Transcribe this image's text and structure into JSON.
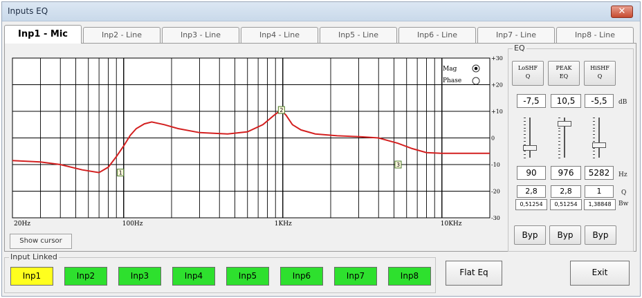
{
  "window": {
    "title": "Inputs EQ",
    "close_glyph": "✕"
  },
  "tabs": [
    {
      "label": "Inp1 - Mic",
      "active": true
    },
    {
      "label": "Inp2 - Line",
      "active": false
    },
    {
      "label": "Inp3 - Line",
      "active": false
    },
    {
      "label": "Inp4 - Line",
      "active": false
    },
    {
      "label": "Inp5 - Line",
      "active": false
    },
    {
      "label": "Inp6 - Line",
      "active": false
    },
    {
      "label": "Inp7 - Line",
      "active": false
    },
    {
      "label": "Inp8 - Line",
      "active": false
    }
  ],
  "graph": {
    "x_ticks": [
      "20Hz",
      "100Hz",
      "1KHz",
      "10KHz"
    ],
    "y_ticks": [
      "+30",
      "+20",
      "+10",
      "0",
      "-10",
      "-20",
      "-30"
    ],
    "mode_mag": "Mag",
    "mode_phase": "Phase",
    "selected_mode": "Mag",
    "curve_color": "#d32020",
    "markers": [
      {
        "label": "1",
        "freq": 95,
        "db": -13
      },
      {
        "label": "2",
        "freq": 976,
        "db": 10.5
      },
      {
        "label": "3",
        "freq": 5282,
        "db": -10
      }
    ],
    "curve": [
      [
        20,
        -8.5
      ],
      [
        30,
        -9
      ],
      [
        40,
        -10
      ],
      [
        55,
        -12
      ],
      [
        70,
        -13
      ],
      [
        80,
        -11
      ],
      [
        90,
        -7
      ],
      [
        100,
        -3
      ],
      [
        110,
        1
      ],
      [
        120,
        3.5
      ],
      [
        135,
        5.3
      ],
      [
        150,
        6
      ],
      [
        180,
        5
      ],
      [
        220,
        3.5
      ],
      [
        300,
        2
      ],
      [
        450,
        1.5
      ],
      [
        600,
        2.3
      ],
      [
        750,
        5
      ],
      [
        880,
        8.5
      ],
      [
        976,
        10.5
      ],
      [
        1050,
        8.5
      ],
      [
        1150,
        5
      ],
      [
        1300,
        3
      ],
      [
        1600,
        1.5
      ],
      [
        2200,
        0.8
      ],
      [
        3000,
        0.5
      ],
      [
        4000,
        0
      ],
      [
        5282,
        -2
      ],
      [
        6500,
        -4
      ],
      [
        8000,
        -5.5
      ],
      [
        10000,
        -5.8
      ],
      [
        15000,
        -5.8
      ],
      [
        20000,
        -5.8
      ]
    ]
  },
  "eq": {
    "title": "EQ",
    "bands": [
      {
        "type_line1": "LoSHF",
        "type_line2": "Q",
        "gain": "-7,5",
        "freq": "90",
        "q": "2,8",
        "bw": "0,51254",
        "bypass": "Byp",
        "gain_value_db": -7.5
      },
      {
        "type_line1": "PEAK",
        "type_line2": "EQ",
        "gain": "10,5",
        "freq": "976",
        "q": "2,8",
        "bw": "0,51254",
        "bypass": "Byp",
        "gain_value_db": 10.5
      },
      {
        "type_line1": "HiSHF",
        "type_line2": "Q",
        "gain": "-5,5",
        "freq": "5282",
        "q": "1",
        "bw": "1,38848",
        "bypass": "Byp",
        "gain_value_db": -5.5
      }
    ],
    "units": {
      "gain": "dB",
      "freq": "Hz",
      "q": "Q",
      "bw": "Bw"
    }
  },
  "show_cursor_label": "Show cursor",
  "input_linked": {
    "title": "Input Linked",
    "buttons": [
      {
        "label": "Inp1",
        "selected": true
      },
      {
        "label": "Inp2",
        "selected": false
      },
      {
        "label": "Inp3",
        "selected": false
      },
      {
        "label": "Inp4",
        "selected": false
      },
      {
        "label": "Inp5",
        "selected": false
      },
      {
        "label": "Inp6",
        "selected": false
      },
      {
        "label": "Inp7",
        "selected": false
      },
      {
        "label": "Inp8",
        "selected": false
      }
    ]
  },
  "actions": {
    "flat_eq": "Flat Eq",
    "exit": "Exit"
  }
}
